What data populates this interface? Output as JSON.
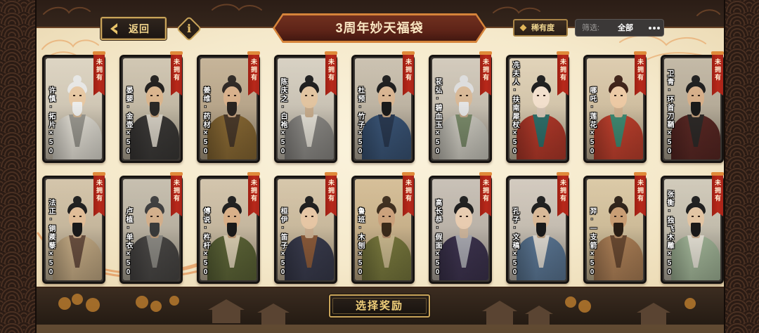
{
  "header": {
    "back_label": "返回",
    "back_icon": "chevron-left-icon",
    "info_label": "i",
    "title": "3周年妙天福袋",
    "rarity_label": "稀有度",
    "rarity_icon": "diamond-icon",
    "filter_label": "筛选:",
    "filter_value": "全部",
    "more_icon": "more-dots-icon"
  },
  "cards": [
    {
      "label": "许慎·拓片×50",
      "status": "未拥有",
      "bg": "#cfc6b4",
      "robe": "#e4e0d6",
      "accent": "#9a9890",
      "hair": "#e6e6e4",
      "skin": "#e6c7a2",
      "beard": "#ececea"
    },
    {
      "label": "晏婴·金壶×50",
      "status": "未拥有",
      "bg": "#c2b8a4",
      "robe": "#3c3a38",
      "accent": "#d6d0c4",
      "hair": "#1e1c1a",
      "skin": "#d9b48c",
      "beard": "#2a2826"
    },
    {
      "label": "姜维·药材×50",
      "status": "未拥有",
      "bg": "#b7a58a",
      "robe": "#8a6a34",
      "accent": "#4a3a2a",
      "hair": "#2a2420",
      "skin": "#d8b08a",
      "beard": "#2a2420"
    },
    {
      "label": "陈庆之·白袍×50",
      "status": "未拥有",
      "bg": "#c9c2b4",
      "robe": "#8e8c88",
      "accent": "#e2ded4",
      "hair": "#1a1a1a",
      "skin": "#e2c4a0",
      "beard": null
    },
    {
      "label": "杜预·竹子×50",
      "status": "未拥有",
      "bg": "#bdb3a2",
      "robe": "#3b5678",
      "accent": "#2a3a52",
      "hair": "#1a1a1a",
      "skin": "#d8b490",
      "beard": "#1a1a1a"
    },
    {
      "label": "苌弘·碧血玉×50",
      "status": "未拥有",
      "bg": "#c4bcae",
      "robe": "#cfccc2",
      "accent": "#7a8a6a",
      "hair": "#dcdcdc",
      "skin": "#d8b896",
      "beard": "#e4e4e4"
    },
    {
      "label": "冼夫人·扶南犀杖×50",
      "status": "未拥有",
      "bg": "#d2c4aa",
      "robe": "#b53a2a",
      "accent": "#2f6f6a",
      "hair": "#1a1a1a",
      "skin": "#f2dfcc",
      "beard": null
    },
    {
      "label": "哪吒·莲花×50",
      "status": "未拥有",
      "bg": "#cfbea0",
      "robe": "#c2412e",
      "accent": "#3f8a72",
      "hair": "#3a1e14",
      "skin": "#ecc9a4",
      "beard": null
    },
    {
      "label": "卫青·环首刀鞘×50",
      "status": "未拥有",
      "bg": "#b5ab98",
      "robe": "#5a2824",
      "accent": "#2e2a28",
      "hair": "#1a1a1a",
      "skin": "#d6ae88",
      "beard": "#1a1a1a"
    },
    {
      "label": "法正·铜蒺藜×50",
      "status": "未拥有",
      "bg": "#c5b69c",
      "robe": "#c7ad86",
      "accent": "#6a5040",
      "hair": "#1a1a1a",
      "skin": "#e0bc96",
      "beard": "#1a1a1a"
    },
    {
      "label": "卢植·单衣×50",
      "status": "未拥有",
      "bg": "#b8b0a0",
      "robe": "#4a4846",
      "accent": "#8c8a84",
      "hair": "#3a3a3a",
      "skin": "#d2ae8a",
      "beard": "#3a3a3a"
    },
    {
      "label": "傅说·杵杆×50",
      "status": "未拥有",
      "bg": "#c4b69e",
      "robe": "#5e6638",
      "accent": "#d8ccb0",
      "hair": "#1a1a1a",
      "skin": "#d8ae86",
      "beard": "#1a1a1a"
    },
    {
      "label": "桓伊·笛子×50",
      "status": "未拥有",
      "bg": "#c8b89c",
      "robe": "#3a3c4e",
      "accent": "#8a5a3a",
      "hair": "#1a1a1a",
      "skin": "#e6c6a4",
      "beard": null
    },
    {
      "label": "鲁班·木刨×50",
      "status": "未拥有",
      "bg": "#c7b08a",
      "robe": "#7a7a3e",
      "accent": "#c9b88e",
      "hair": "#3a2a1a",
      "skin": "#caa07a",
      "beard": "#3a2a1a"
    },
    {
      "label": "高长恭·假面×50",
      "status": "未拥有",
      "bg": "#bab2a8",
      "robe": "#3e3450",
      "accent": "#a8a8b0",
      "hair": "#1a1a1a",
      "skin": "#e8ccb0",
      "beard": null
    },
    {
      "label": "孔子·文稿×50",
      "status": "未拥有",
      "bg": "#c4bcb0",
      "robe": "#5c7896",
      "accent": "#dcd8d0",
      "hair": "#1a1a1a",
      "skin": "#d8b896",
      "beard": "#1a1a1a"
    },
    {
      "label": "羿·一支箭×50",
      "status": "未拥有",
      "bg": "#cdbb98",
      "robe": "#b08258",
      "accent": "#6a4a32",
      "hair": "#2a1e14",
      "skin": "#c89c72",
      "beard": "#2a1e14"
    },
    {
      "label": "张衡·独飞木雕×50",
      "status": "未拥有",
      "bg": "#c2bcac",
      "robe": "#a4b89a",
      "accent": "#e4e0d4",
      "hair": "#1a1a1a",
      "skin": "#e2c4a2",
      "beard": "#1a1a1a"
    }
  ],
  "footer": {
    "select_label": "选择奖励"
  },
  "colors": {
    "gold": "#c9a45a",
    "ribbon": "#b8281a",
    "banner": "#5e2418",
    "panel": "#f5e9cb"
  }
}
